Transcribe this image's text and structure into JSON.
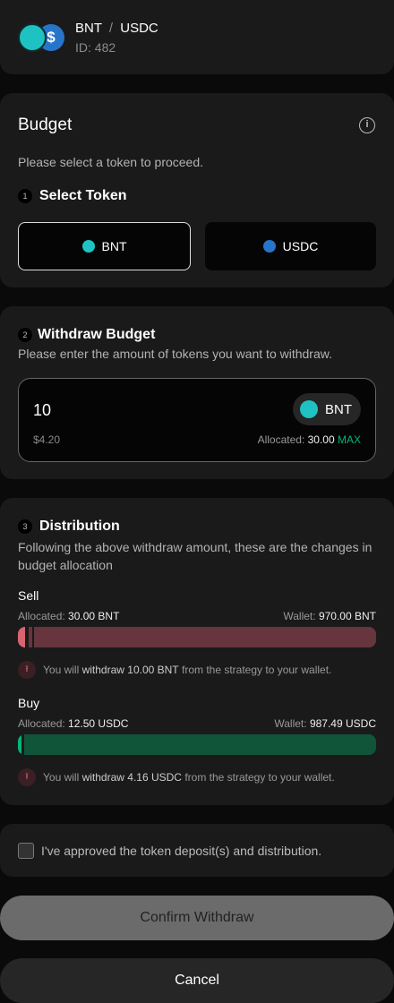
{
  "header": {
    "base": "BNT",
    "separator": "/",
    "quote": "USDC",
    "id": "ID: 482"
  },
  "budget": {
    "title": "Budget",
    "subtitle": "Please select a token to proceed.",
    "step1": "1",
    "step1_title": "Select Token",
    "tokens": [
      {
        "label": "BNT",
        "selected": true
      },
      {
        "label": "USDC",
        "selected": false
      }
    ]
  },
  "withdraw": {
    "step": "2",
    "title": "Withdraw Budget",
    "subtitle": "Please enter the amount of tokens you want to withdraw.",
    "amount": "10",
    "token": "BNT",
    "usd": "$4.20",
    "allocated_label": "Allocated:",
    "allocated_value": "30.00",
    "max": "MAX"
  },
  "distribution": {
    "step": "3",
    "title": "Distribution",
    "subtitle": "Following the above withdraw amount, these are the changes in budget allocation",
    "sell": {
      "label": "Sell",
      "allocated_label": "Allocated:",
      "allocated": "30.00 BNT",
      "wallet_label": "Wallet:",
      "wallet": "970.00 BNT",
      "note_pre": "You will",
      "note_bold": "withdraw 10.00 BNT",
      "note_post": "from the strategy to your wallet.",
      "fill_pct": 2,
      "withdraw_pct": 1
    },
    "buy": {
      "label": "Buy",
      "allocated_label": "Allocated:",
      "allocated": "12.50 USDC",
      "wallet_label": "Wallet:",
      "wallet": "987.49 USDC",
      "note_pre": "You will",
      "note_bold": "withdraw 4.16 USDC",
      "note_post": "from the strategy to your wallet.",
      "fill_pct": 1
    }
  },
  "approval": {
    "label": "I've approved the token deposit(s) and distribution.",
    "checked": false
  },
  "buttons": {
    "confirm": "Confirm Withdraw",
    "cancel": "Cancel"
  },
  "colors": {
    "bnt": "#1fc2c2",
    "usdc": "#2775ca",
    "sell": "#d86371",
    "sell_bg": "#66353d",
    "buy": "#00b578",
    "buy_bg": "#10543a"
  }
}
